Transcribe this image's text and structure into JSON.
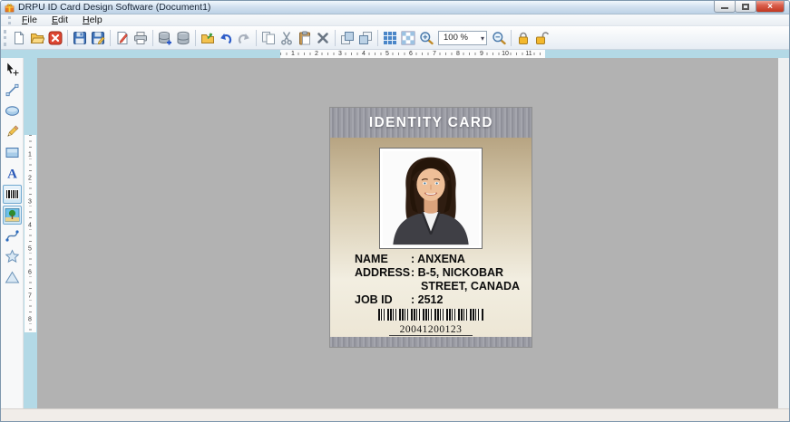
{
  "window": {
    "title": "DRPU ID Card Design Software  (Document1)",
    "app_icon": "gift-box-icon",
    "controls": [
      "minimize",
      "maximize",
      "close"
    ]
  },
  "menu": {
    "items": [
      "File",
      "Edit",
      "Help"
    ]
  },
  "toolbar": {
    "zoom_value": "100 %",
    "groups": [
      [
        "new-document",
        "open-file",
        "close-document"
      ],
      [
        "save",
        "save-as"
      ],
      [
        "page-setup",
        "print"
      ],
      [
        "add-database",
        "database"
      ],
      [
        "export",
        "undo",
        "redo"
      ],
      [
        "copy",
        "cut",
        "paste",
        "delete"
      ],
      [
        "bring-to-front",
        "send-to-back"
      ],
      [
        "show-grid",
        "snap-to-grid",
        "zoom-in",
        "zoom-combo",
        "zoom-out"
      ],
      [
        "lock",
        "unlock"
      ]
    ]
  },
  "toolbox": {
    "items": [
      "select",
      "line",
      "ellipse",
      "pencil",
      "rectangle",
      "text",
      "barcode",
      "image",
      "curve",
      "star",
      "triangle"
    ],
    "selected": [
      "barcode",
      "image"
    ]
  },
  "rulers": {
    "horizontal_units": [
      1,
      2,
      3,
      4,
      5,
      6,
      7,
      8,
      9,
      10,
      11
    ],
    "vertical_units": [
      1,
      2,
      3,
      4,
      5,
      6,
      7,
      8
    ]
  },
  "card": {
    "title": "IDENTITY CARD",
    "photo": "woman-portrait",
    "fields": [
      {
        "label": "NAME",
        "value": ": ANXENA",
        "indent": false
      },
      {
        "label": "ADDRESS",
        "value": ": B-5, NICKOBAR",
        "indent": false
      },
      {
        "label": "",
        "value": "STREET, CANADA",
        "indent": true
      },
      {
        "label": "JOB ID",
        "value": ": 2512",
        "indent": false
      }
    ],
    "barcode_value": "20041200123"
  },
  "statusbar": {
    "text": ""
  },
  "colors": {
    "ruler_band_blue": "#b3d9e6",
    "canvas_gray": "#b2b2b2",
    "card_tan_top": "#b7a482",
    "card_light": "#f2eee1",
    "stripe_gray": "#95969f",
    "close_button_red": "#d95f4d",
    "lock_gold": "#f3b82d",
    "toolbar_blue_accent": "#4a86c8"
  }
}
